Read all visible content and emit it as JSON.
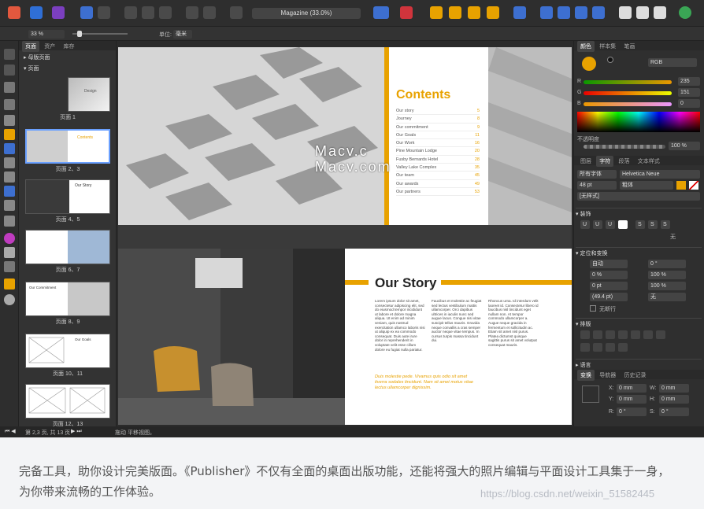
{
  "toolbar": {
    "document_title": "Magazine (33.0%)"
  },
  "context_bar": {
    "zoom": "33 %",
    "unit_label": "单位:",
    "unit_value": "毫米"
  },
  "pages_panel": {
    "tabs": [
      "页面",
      "资产",
      "库存"
    ],
    "master_label": "母版页面",
    "pages_label": "页面",
    "thumbnails": [
      {
        "label": "页面 1",
        "title": "Design"
      },
      {
        "label": "页面 2、3",
        "title": "Contents"
      },
      {
        "label": "页面 4、5",
        "title": "Our Story"
      },
      {
        "label": "页面 6、7",
        "title": ""
      },
      {
        "label": "页面 8、9",
        "title": "Our Commitment"
      },
      {
        "label": "页面 10、11",
        "title": "Our Goals"
      },
      {
        "label": "页面 12、13",
        "title": ""
      }
    ]
  },
  "spread_top": {
    "contents_title": "Contents",
    "toc": [
      {
        "title": "Our story",
        "page": "5"
      },
      {
        "title": "Journey",
        "page": "8"
      },
      {
        "title": "Our commitment",
        "page": "9"
      },
      {
        "title": "Our Goals",
        "page": "11"
      },
      {
        "title": "Our Work",
        "page": "16"
      },
      {
        "title": "Pine Mountain Lodge",
        "page": "20"
      },
      {
        "title": "Fusby Bernards Hotel",
        "page": "28"
      },
      {
        "title": "Valley Lake Complex",
        "page": "35"
      },
      {
        "title": "Our team",
        "page": "45"
      },
      {
        "title": "Our awards",
        "page": "49"
      },
      {
        "title": "Our partners",
        "page": "53"
      }
    ]
  },
  "spread_bottom": {
    "story_title": "Our Story",
    "col1": "Lorem ipsum dolor sit amet, consectetur adipiscing elit, sed do eiusmod tempor incididunt ut labore et dolore magna aliqua. Ut enim ad minim veniam, quis nostrud exercitation ullamco laboris nisi ut aliquip ex ea commodo consequat. Duis aute irure dolor in reprehenderit in voluptate velit esse cillum dolore eu fugiat nulla pariatur.",
    "col2": "Faucibus et molestie ac feugiat sed lectus vestibulum mattis ullamcorper. Orci dapibus ultrices in iaculis nunc sed augue lacus. Congue nisi vitae suscipit tellus mauris. Gravida neque convallis a cras semper auctor neque vitae tempus. In cursus turpis massa tincidunt dui.",
    "col3": "Rhoncus urna. Id interdum velit laoreet id. Consectetur libero id faucibus nisl tincidunt eget nullam non. At tempor commodo ullamcorper a. Augue neque gravida in fermentum et sollicitudin ac. Etiam sit amet nisl purus. Platea dictumst quisque sagittis purus sit amet volutpat consequat mauris.",
    "quote": "Duis molestie pede. Vivamus quis odio sit amet tiverra sodales tincidunt. Nam sit amet motus vitae lectus ullamcorper dignissim."
  },
  "canvas_watermark": [
    "Macv.c",
    "Macv.com"
  ],
  "right_panel": {
    "tabs_top": [
      "颜色",
      "样本集",
      "笔画"
    ],
    "color_mode": "RGB",
    "r_value": "235",
    "g_value": "151",
    "b_value": "0",
    "opacity_label": "不透明度",
    "opacity_value": "100 %",
    "tabs_mid": [
      "图层",
      "字符",
      "段落",
      "文本样式"
    ],
    "font_collection": "所有字体",
    "font_family": "Helvetica Neue",
    "font_size": "48 pt",
    "font_weight": "粗体",
    "style_none": "[无样式]",
    "decoration_section": "装饰",
    "decoration_none": "无",
    "positioning_section": "定位和变换",
    "auto1": "自动",
    "kern": "0 %",
    "auto2": "自动",
    "zero_pt": "0 pt",
    "lead": "(49.4 pt)",
    "angle": "0 °",
    "scale_w": "100 %",
    "scale_h": "100 %",
    "baseline_none": "无",
    "no_break": "无断行",
    "typography_section": "排版",
    "language_section": "语言",
    "tabs_bottom": [
      "变换",
      "导航器",
      "历史记录"
    ],
    "x_label": "X:",
    "x_value": "0 mm",
    "y_label": "Y:",
    "y_value": "0 mm",
    "w_label": "W:",
    "w_value": "0 mm",
    "h_label": "H:",
    "h_value": "0 mm",
    "r_label": "R:",
    "r_rot": "0 °",
    "s_label": "S:",
    "s_value": "0 °"
  },
  "status_bar": {
    "page_info": "第 2,3 页, 共 13 页",
    "hint": "拖动 平移视图。"
  },
  "caption_text": "完备工具，助你设计完美版面。《Publisher》不仅有全面的桌面出版功能，还能将强大的照片编辑与平面设计工具集于一身，为你带来流畅的工作体验。",
  "url_watermark": "https://blog.csdn.net/weixin_51582445",
  "colors": {
    "accent": "#e8a200",
    "dark": "#2b2b2b",
    "panel": "#333333"
  }
}
